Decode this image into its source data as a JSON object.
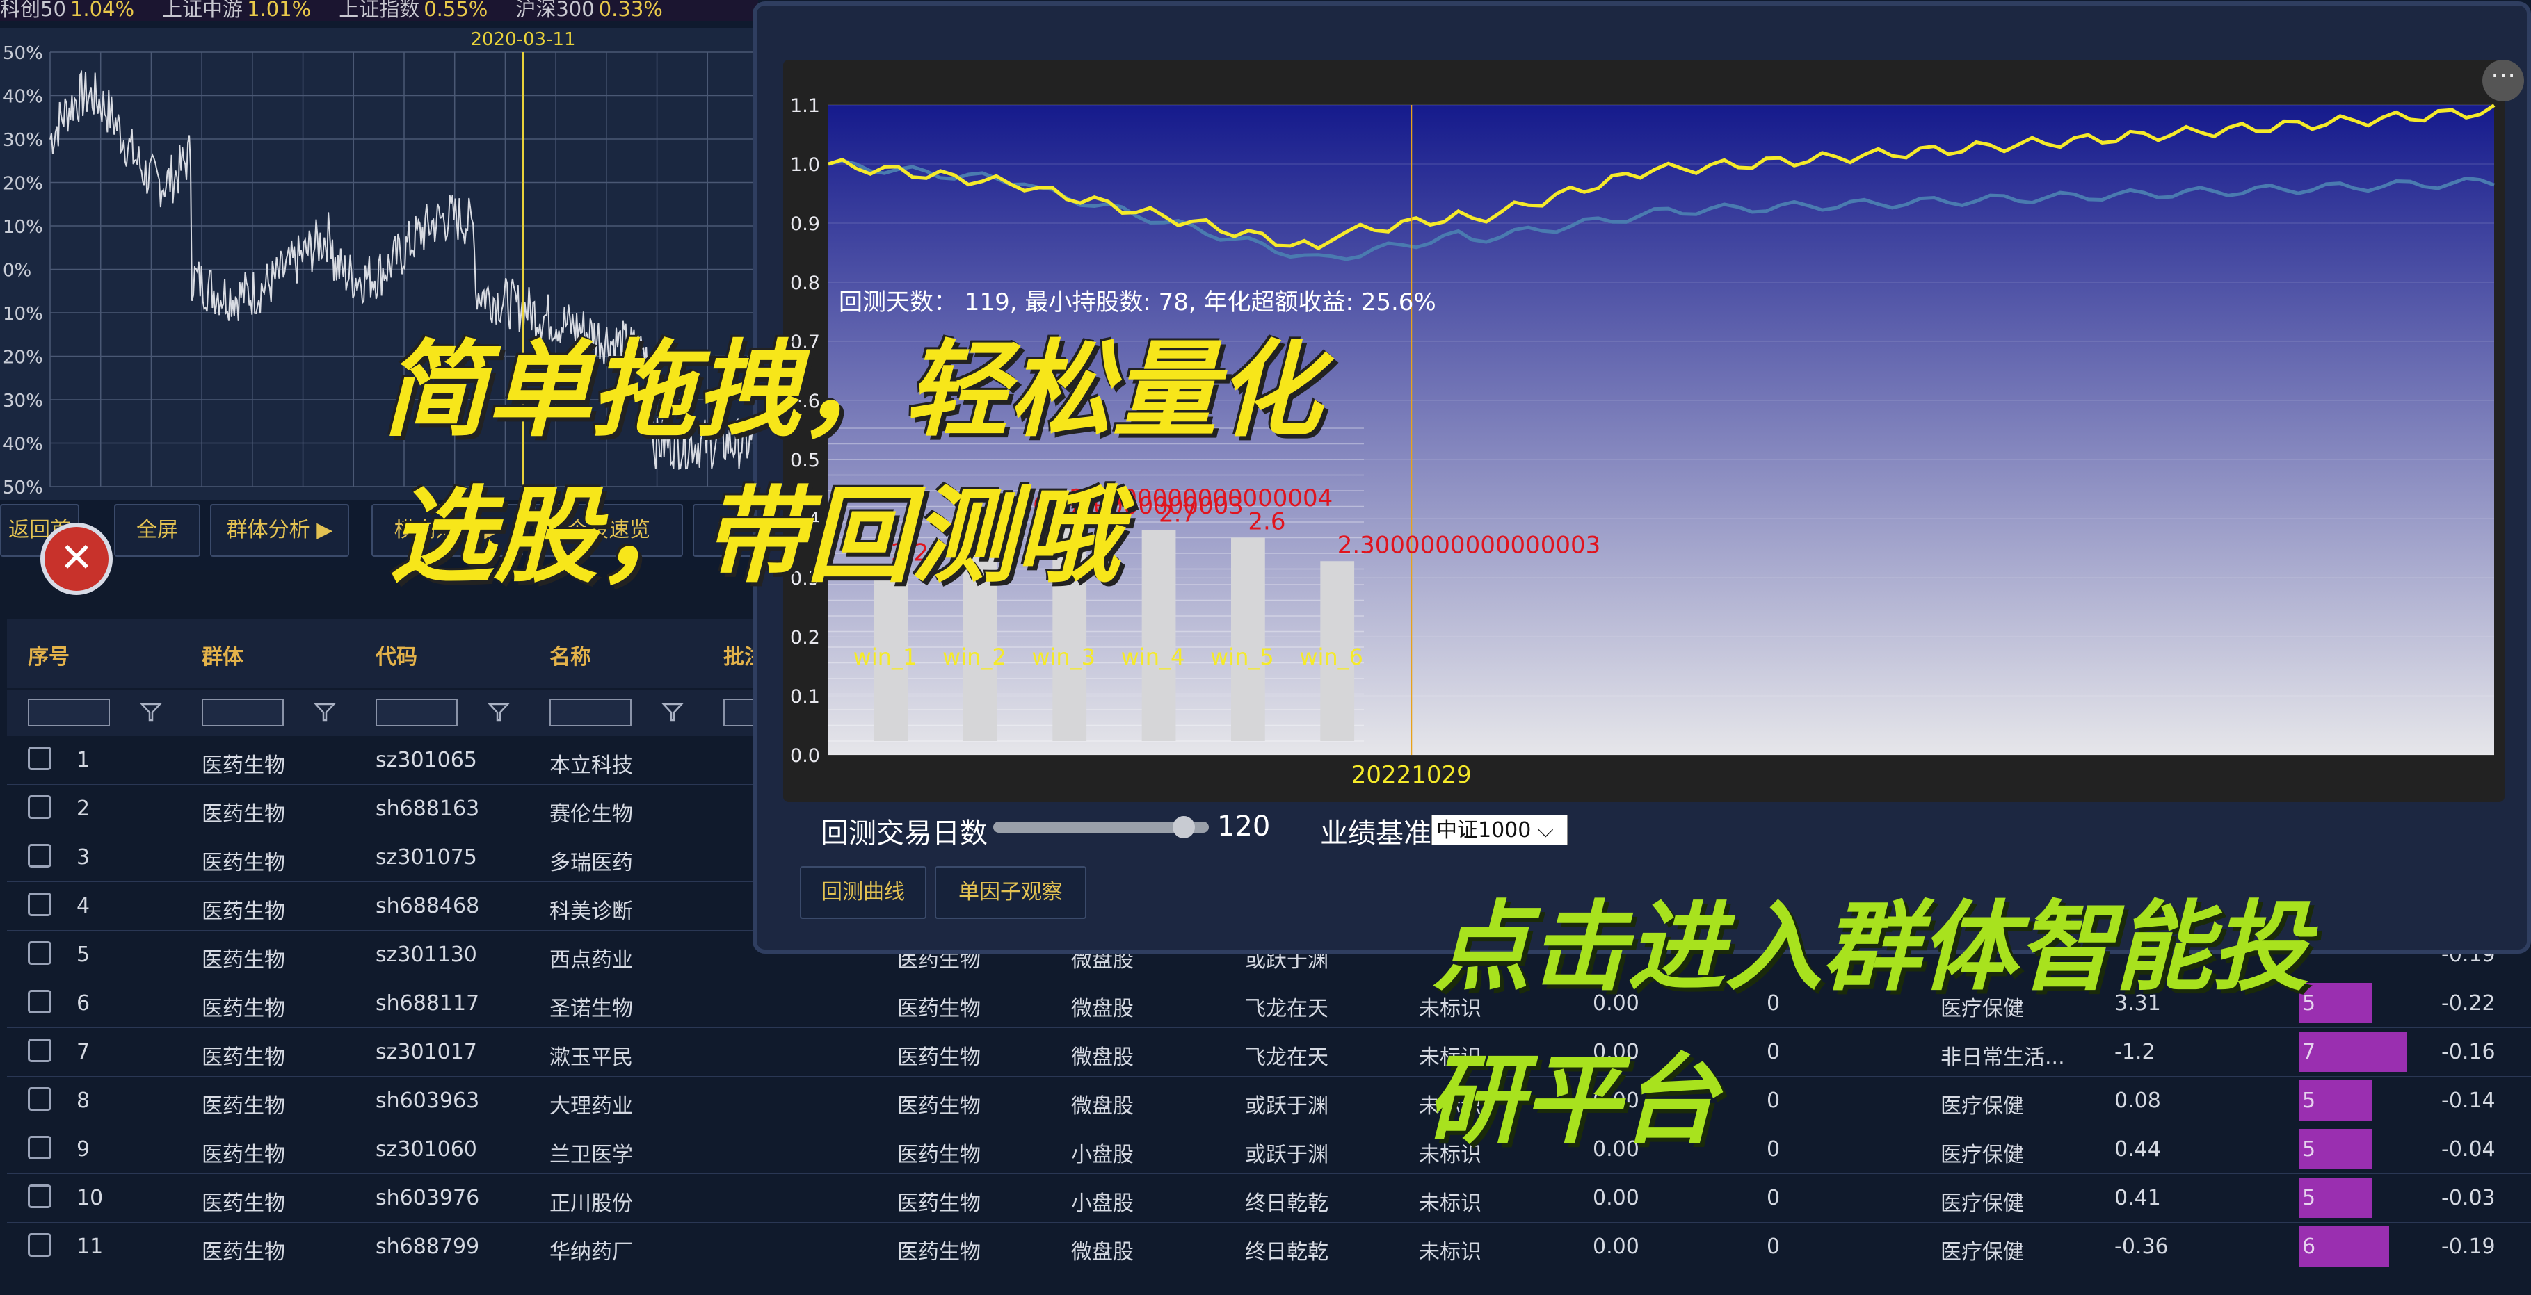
{
  "ticker": [
    {
      "name": "科创50",
      "value": "1.04%"
    },
    {
      "name": "上证中游",
      "value": "1.01%"
    },
    {
      "name": "上证指数",
      "value": "0.55%"
    },
    {
      "name": "沪深300",
      "value": "0.33%"
    }
  ],
  "left_chart": {
    "date_label": "2020-03-11",
    "y_ticks": [
      "50%",
      "40%",
      "30%",
      "20%",
      "10%",
      "0%",
      "10%",
      "20%",
      "30%",
      "40%",
      "50%"
    ]
  },
  "toolbar": {
    "buttons": [
      "返回首页",
      "全屏",
      "群体分析 ▶",
      "横向对比 ▶",
      "个股速览",
      "方"
    ]
  },
  "table": {
    "headers": [
      "序号",
      "群体",
      "代码",
      "名称",
      "批注"
    ],
    "rows": [
      {
        "idx": "1",
        "group": "医药生物",
        "code": "sz301065",
        "name": "本立科技"
      },
      {
        "idx": "2",
        "group": "医药生物",
        "code": "sh688163",
        "name": "赛伦生物"
      },
      {
        "idx": "3",
        "group": "医药生物",
        "code": "sz301075",
        "name": "多瑞医药"
      },
      {
        "idx": "4",
        "group": "医药生物",
        "code": "sh688468",
        "name": "科美诊断"
      },
      {
        "idx": "5",
        "group": "医药生物",
        "code": "sz301130",
        "name": "西点药业",
        "c1": "医药生物",
        "c2": "微盘股",
        "c3": "或跃于渊",
        "c4": "",
        "c5": "",
        "c6": "",
        "c7": "",
        "c8": "",
        "c9": "",
        "c10": "-0.19"
      },
      {
        "idx": "6",
        "group": "医药生物",
        "code": "sh688117",
        "name": "圣诺生物",
        "c1": "医药生物",
        "c2": "微盘股",
        "c3": "飞龙在天",
        "c4": "未标识",
        "c5": "0.00",
        "c6": "0",
        "c7": "医疗保健",
        "c8": "3.31",
        "c9": "5",
        "c10": "-0.22",
        "bar": 0.42
      },
      {
        "idx": "7",
        "group": "医药生物",
        "code": "sz301017",
        "name": "漱玉平民",
        "c1": "医药生物",
        "c2": "微盘股",
        "c3": "飞龙在天",
        "c4": "未标识",
        "c5": "0.00",
        "c6": "0",
        "c7": "非日常生活...",
        "c8": "-1.2",
        "c9": "7",
        "c10": "-0.16",
        "bar": 0.62
      },
      {
        "idx": "8",
        "group": "医药生物",
        "code": "sh603963",
        "name": "大理药业",
        "c1": "医药生物",
        "c2": "微盘股",
        "c3": "或跃于渊",
        "c4": "未标识",
        "c5": "0.00",
        "c6": "0",
        "c7": "医疗保健",
        "c8": "0.08",
        "c9": "5",
        "c10": "-0.14",
        "bar": 0.42
      },
      {
        "idx": "9",
        "group": "医药生物",
        "code": "sz301060",
        "name": "兰卫医学",
        "c1": "医药生物",
        "c2": "小盘股",
        "c3": "或跃于渊",
        "c4": "未标识",
        "c5": "0.00",
        "c6": "0",
        "c7": "医疗保健",
        "c8": "0.44",
        "c9": "5",
        "c10": "-0.04",
        "bar": 0.42
      },
      {
        "idx": "10",
        "group": "医药生物",
        "code": "sh603976",
        "name": "正川股份",
        "c1": "医药生物",
        "c2": "小盘股",
        "c3": "终日乾乾",
        "c4": "未标识",
        "c5": "0.00",
        "c6": "0",
        "c7": "医疗保健",
        "c8": "0.41",
        "c9": "5",
        "c10": "-0.03",
        "bar": 0.42
      },
      {
        "idx": "11",
        "group": "医药生物",
        "code": "sh688799",
        "name": "华纳药厂",
        "c1": "医药生物",
        "c2": "微盘股",
        "c3": "终日乾乾",
        "c4": "未标识",
        "c5": "0.00",
        "c6": "0",
        "c7": "医疗保健",
        "c8": "-0.36",
        "c9": "6",
        "c10": "-0.19",
        "bar": 0.52
      }
    ]
  },
  "modal": {
    "summary": "回测天数： 119, 最小持股数: 78, 年化超额收益: 25.6%",
    "marker_date": "20221029",
    "y_ticks": [
      "1.1",
      "1.0",
      "0.9",
      "0.8",
      "0.7",
      "0.6",
      "0.5",
      "0.4",
      "0.3",
      "0.2",
      "0.1",
      "0.0"
    ],
    "slider_label": "回测交易日数",
    "slider_value": "120",
    "benchmark_label": "业绩基准",
    "benchmark_selected": "中证1000",
    "buttons": [
      "回测曲线",
      "单因子观察"
    ],
    "more_icon": "⋯"
  },
  "chart_data": {
    "type": "bar",
    "categories": [
      "win_1",
      "win_2",
      "win_3",
      "win_4",
      "win_5",
      "win_6"
    ],
    "values": [
      2.2,
      2.8000000000000003,
      2.9000000000000004,
      2.7,
      2.6,
      2.3000000000000003
    ],
    "value_labels": [
      "2.2",
      "2.8000000000000003",
      "2.9000000000000004",
      "2.7",
      "2.6",
      "2.3000000000000003"
    ],
    "ylim": [
      0,
      4
    ]
  },
  "overlays": {
    "line1": "简单拖拽，轻松量化",
    "line2": "选股，带回测哦",
    "line3": "点击进入群体智能投",
    "line4": "研平台"
  },
  "colors": {
    "accent_gold": "#e3c252",
    "strategy_line": "#f5ea2a",
    "benchmark_line": "#4a7bb0",
    "overlay_yellow": "#f7e61a",
    "overlay_green": "#a8e21e",
    "bar_purple": "#9a2fb0"
  }
}
